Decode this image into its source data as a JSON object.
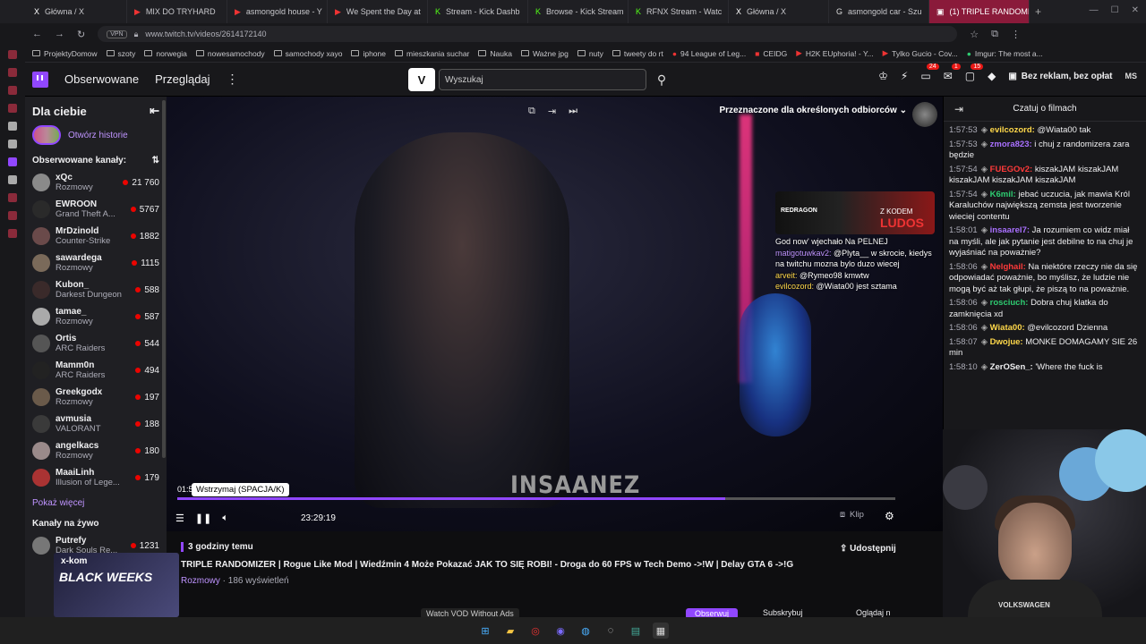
{
  "browser": {
    "tabs": [
      {
        "label": "Główna / X",
        "icon": "x-icon"
      },
      {
        "label": "MIX DO TRYHARD",
        "icon": "youtube-icon"
      },
      {
        "label": "asmongold house - Y",
        "icon": "youtube-icon"
      },
      {
        "label": "We Spent the Day at",
        "icon": "youtube-icon"
      },
      {
        "label": "Stream - Kick Dashb",
        "icon": "kick-icon"
      },
      {
        "label": "Browse - Kick Stream",
        "icon": "kick-icon"
      },
      {
        "label": "RFNX Stream - Watc",
        "icon": "kick-icon"
      },
      {
        "label": "Główna / X",
        "icon": "x-icon"
      },
      {
        "label": "asmongold car - Szu",
        "icon": "google-icon"
      },
      {
        "label": "(1) TRIPLE RANDOMI",
        "icon": "twitch-icon"
      }
    ],
    "url": "www.twitch.tv/videos/2614172140",
    "vpn": "VPN",
    "bookmarks": [
      "ProjektyDomow",
      "szoty",
      "norwegia",
      "nowesamochody",
      "samochody xayo",
      "iphone",
      "mieszkania suchar",
      "Nauka",
      "Ważne jpg",
      "nuty",
      "tweety do rt",
      "94 League of Leg...",
      "CEIDG",
      "H2K EUphoria! - Y...",
      "Tylko Gucio - Cov...",
      "Imgur: The most a..."
    ]
  },
  "twitch_nav": {
    "following": "Obserwowane",
    "browse": "Przeglądaj",
    "vlogo": "V",
    "search_placeholder": "Wyszukaj",
    "badges": [
      "24",
      "1",
      "15"
    ],
    "turbo": "Bez reklam, bez opłat",
    "avatar": "MS"
  },
  "sidebar": {
    "title": "Dla ciebie",
    "story": "Otwórz historie",
    "followed_title": "Obserwowane kanały:",
    "channels": [
      {
        "name": "xQc",
        "game": "Rozmowy",
        "viewers": "21 760"
      },
      {
        "name": "EWROON",
        "game": "Grand Theft A...",
        "viewers": "5767"
      },
      {
        "name": "MrDzinold",
        "game": "Counter-Strike",
        "viewers": "1882"
      },
      {
        "name": "sawardega",
        "game": "Rozmowy",
        "viewers": "1115"
      },
      {
        "name": "Kubon_",
        "game": "Darkest Dungeon",
        "viewers": "588"
      },
      {
        "name": "tamae_",
        "game": "Rozmowy",
        "viewers": "587"
      },
      {
        "name": "Ortis",
        "game": "ARC Raiders",
        "viewers": "544"
      },
      {
        "name": "Mamm0n",
        "game": "ARC Raiders",
        "viewers": "494"
      },
      {
        "name": "Greekgodx",
        "game": "Rozmowy",
        "viewers": "197"
      },
      {
        "name": "avmusia",
        "game": "VALORANT",
        "viewers": "188"
      },
      {
        "name": "angelkacs",
        "game": "Rozmowy",
        "viewers": "180"
      },
      {
        "name": "MaaiLinh",
        "game": "Illusion of Lege...",
        "viewers": "179"
      }
    ],
    "show_more": "Pokaż więcej",
    "live_title": "Kanały na żywo",
    "live_channels": [
      {
        "name": "Putrefy",
        "game": "Dark Souls Re...",
        "viewers": "1231"
      }
    ]
  },
  "video": {
    "mature_label": "Przeznaczone dla określonych odbiorców",
    "ad_brand": "REDRAGON",
    "ad_text": "Z KODEM",
    "ad_code": "LUDOS",
    "overlay_chat": [
      {
        "user": "",
        "text": "God now' wjechało Na PELNEJ"
      },
      {
        "user": "matigotuwkav2:",
        "text": "@Plyta__ w skrocie, kiedys na twitchu mozna bylo duzo wiecej"
      },
      {
        "user": "arveit:",
        "text": "@Rymeo98 kmwtw"
      },
      {
        "user": "evilcozord:",
        "text": "@Wiata00 jest sztama"
      }
    ],
    "watermark": "INSAANEZ",
    "time_current": "01:5",
    "tooltip": "Wstrzymaj (SPACJA/K)",
    "duration": "23:29:19",
    "progress_fraction": 0.763,
    "clip": "Klip"
  },
  "below": {
    "ago": "3 godziny temu",
    "title": "TRIPLE RANDOMIZER | Rogue Like Mod | Wiedźmin 4 Może Pokazać JAK TO SIĘ ROBI! - Droga do 60 FPS w Tech Demo ->!W | Delay GTA 6 ->!G",
    "category": "Rozmowy",
    "views": " · 186 wyświetleń",
    "share": "Udostępnij",
    "vod_button": "Watch VOD Without Ads",
    "follow": "Obserwuj",
    "subscribe": "Subskrybuj",
    "watch": "Oglądaj n"
  },
  "promo": {
    "brand": "x-kom",
    "headline": "BLACK WEEKS"
  },
  "chat": {
    "title": "Czatuj o filmach",
    "messages": [
      {
        "time": "1:57:53",
        "user": "evilcozord:",
        "color": "#ffd84a",
        "text": "@Wiata00 tak"
      },
      {
        "time": "1:57:53",
        "user": "zmora823:",
        "color": "#a970ff",
        "text": "i chuj z randomizera zara będzie"
      },
      {
        "time": "1:57:54",
        "user": "FUEGOv2:",
        "color": "#ff3a3a",
        "text": "kiszakJAM kiszakJAM kiszakJAM kiszakJAM kiszakJAM"
      },
      {
        "time": "1:57:54",
        "user": "K6mil:",
        "color": "#2ecc71",
        "text": "jebać uczucia, jak mawia Król Karaluchów największą zemsta jest tworzenie wieciej contentu"
      },
      {
        "time": "1:58:01",
        "user": "insaarel7:",
        "color": "#a970ff",
        "text": "Ja rozumiem co widz miał na myśli, ale jak pytanie jest debilne to na chuj je wyjaśniać na poważnie?"
      },
      {
        "time": "1:58:06",
        "user": "Nelghail:",
        "color": "#ff3a3a",
        "text": "Na niektóre rzeczy nie da się odpowiadać poważnie, bo myślisz, że ludzie nie mogą być aż tak głupi, że piszą to na poważnie."
      },
      {
        "time": "1:58:06",
        "user": "rosciuch:",
        "color": "#2ecc71",
        "text": "Dobra chuj klatka do zamknięcia xd"
      },
      {
        "time": "1:58:06",
        "user": "Wiata00:",
        "color": "#ffd84a",
        "text": "@evilcozord Dzienna"
      },
      {
        "time": "1:58:07",
        "user": "Dwojue:",
        "color": "#ffd84a",
        "text": "MONKE DOMAGAMY SIE 26 min"
      },
      {
        "time": "1:58:10",
        "user": "ZerOSen_:",
        "color": "#efeff1",
        "text": "'Where the fuck is"
      }
    ]
  },
  "webcam": {
    "shirt_text": "VOLKSWAGEN"
  },
  "colors": {
    "twitch_purple": "#9147ff",
    "live_red": "#eb0400",
    "bg": "#0e0e10"
  }
}
